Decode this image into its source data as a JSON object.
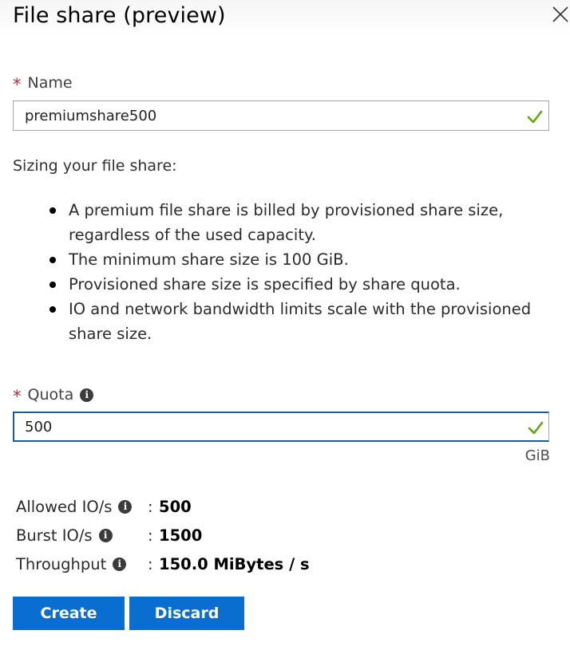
{
  "header": {
    "title": "File share (preview)",
    "close_icon": "close-icon"
  },
  "name_field": {
    "required_mark": "*",
    "label": "Name",
    "value": "premiumshare500",
    "valid": true
  },
  "sizing": {
    "heading": "Sizing your file share:",
    "bullets": [
      "A premium file share is billed by provisioned share size, regardless of the used capacity.",
      "The minimum share size is 100 GiB.",
      "Provisioned share size is specified by share quota.",
      "IO and network bandwidth limits scale with the provisioned share size."
    ]
  },
  "quota_field": {
    "required_mark": "*",
    "label": "Quota",
    "value": "500",
    "unit": "GiB",
    "valid": true
  },
  "stats": [
    {
      "label": "Allowed IO/s",
      "separator": ":",
      "value": "500"
    },
    {
      "label": "Burst IO/s",
      "separator": ":",
      "value": "1500"
    },
    {
      "label": "Throughput",
      "separator": ":",
      "value": "150.0 MiBytes / s"
    }
  ],
  "actions": {
    "create_label": "Create",
    "discard_label": "Discard"
  },
  "colors": {
    "primary_button": "#0a6ed1",
    "required": "#c4262e",
    "valid_check": "#5fa80f",
    "focus_border": "#1f5aa1"
  }
}
